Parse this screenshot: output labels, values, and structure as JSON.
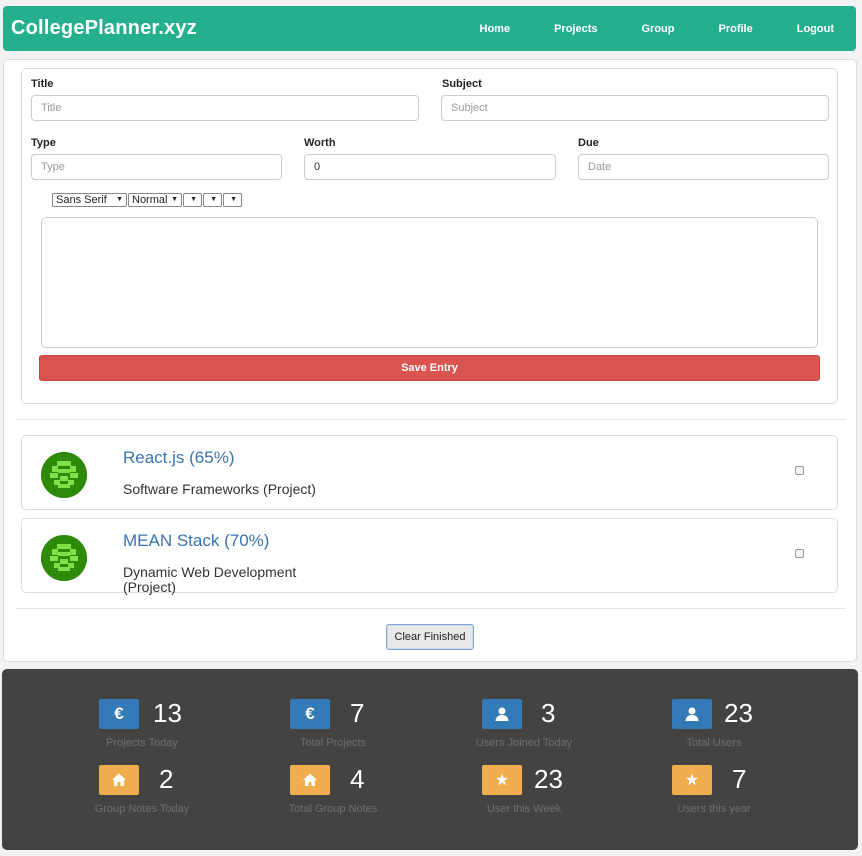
{
  "navbar": {
    "brand": "CollegePlanner.xyz",
    "links": [
      "Home",
      "Projects",
      "Group",
      "Profile",
      "Logout"
    ]
  },
  "form": {
    "title_label": "Title",
    "title_placeholder": "Title",
    "subject_label": "Subject",
    "subject_placeholder": "Subject",
    "type_label": "Type",
    "type_placeholder": "Type",
    "worth_label": "Worth",
    "worth_value": "0",
    "due_label": "Due",
    "due_placeholder": "Date",
    "toolbar": {
      "font": "Sans Serif",
      "size": "Normal"
    },
    "save_label": "Save Entry"
  },
  "entries": [
    {
      "title": "React.js (65%)",
      "subtitle": "Software Frameworks (Project)"
    },
    {
      "title": "MEAN Stack (70%)",
      "subtitle": "Dynamic Web Development (Project)"
    }
  ],
  "clear_label": "Clear Finished",
  "stats": [
    {
      "icon": "euro-icon",
      "color": "blue",
      "value": "13",
      "label": "Projects Today"
    },
    {
      "icon": "euro-icon",
      "color": "blue",
      "value": "7",
      "label": "Total Projects"
    },
    {
      "icon": "user-icon",
      "color": "blue",
      "value": "3",
      "label": "Users Joined Today"
    },
    {
      "icon": "user-icon",
      "color": "blue",
      "value": "23",
      "label": "Total Users"
    },
    {
      "icon": "home-icon",
      "color": "orange",
      "value": "2",
      "label": "Group Notes Today"
    },
    {
      "icon": "home-icon",
      "color": "orange",
      "value": "4",
      "label": "Total Group Notes"
    },
    {
      "icon": "star-icon",
      "color": "orange",
      "value": "23",
      "label": "User this Week"
    },
    {
      "icon": "star-icon",
      "color": "orange",
      "value": "7",
      "label": "Users this year"
    }
  ],
  "colors": {
    "navbar": "#24af8d",
    "save": "#d9534f",
    "link": "#3a73b0",
    "stats_bg": "#434342",
    "tile_blue": "#337ab7",
    "tile_orange": "#f0ad4e"
  }
}
